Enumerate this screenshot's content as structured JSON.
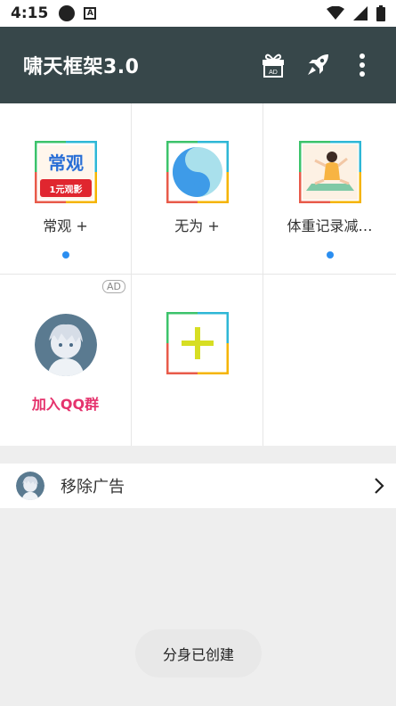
{
  "status_bar": {
    "time": "4:15",
    "a_badge": "A"
  },
  "app_bar": {
    "title": "啸天框架3.0",
    "gift_ad_label": "AD"
  },
  "grid": {
    "items": [
      {
        "label": "常观 +",
        "icon_text_top": "常观",
        "icon_text_bottom": "1元观影",
        "has_dot": true
      },
      {
        "label": "无为 +",
        "has_dot": false
      },
      {
        "label": "体重记录减…",
        "has_dot": true
      },
      {
        "label": "加入QQ群",
        "badge": "AD"
      },
      {
        "label": ""
      },
      {
        "label": ""
      }
    ]
  },
  "remove_ads": {
    "label": "移除广告"
  },
  "toast": {
    "text": "分身已创建"
  },
  "colors": {
    "app_bar": "#37474a",
    "dot": "#2b8ef0",
    "qq_label": "#e5336d",
    "plus": "#d7de23"
  }
}
